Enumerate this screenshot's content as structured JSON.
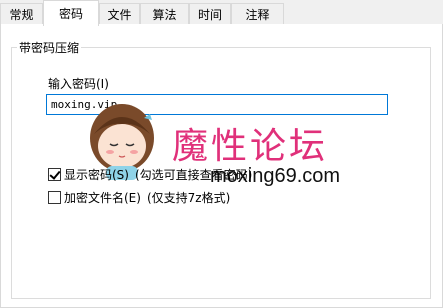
{
  "tabs": [
    "常规",
    "密码",
    "文件",
    "算法",
    "时间",
    "注释"
  ],
  "group": {
    "title": "带密码压缩"
  },
  "password": {
    "label": "输入密码(I)",
    "value": "moxing.vip"
  },
  "options": {
    "show_password": {
      "label": "显示密码(S)",
      "note": "(勾选可直接查看密码)",
      "checked": true
    },
    "encrypt_names": {
      "label": "加密文件名(E)",
      "note": "(仅支持7z格式)",
      "checked": false
    }
  },
  "watermark": {
    "text": "魔性论坛",
    "url": "moxing69.com"
  }
}
